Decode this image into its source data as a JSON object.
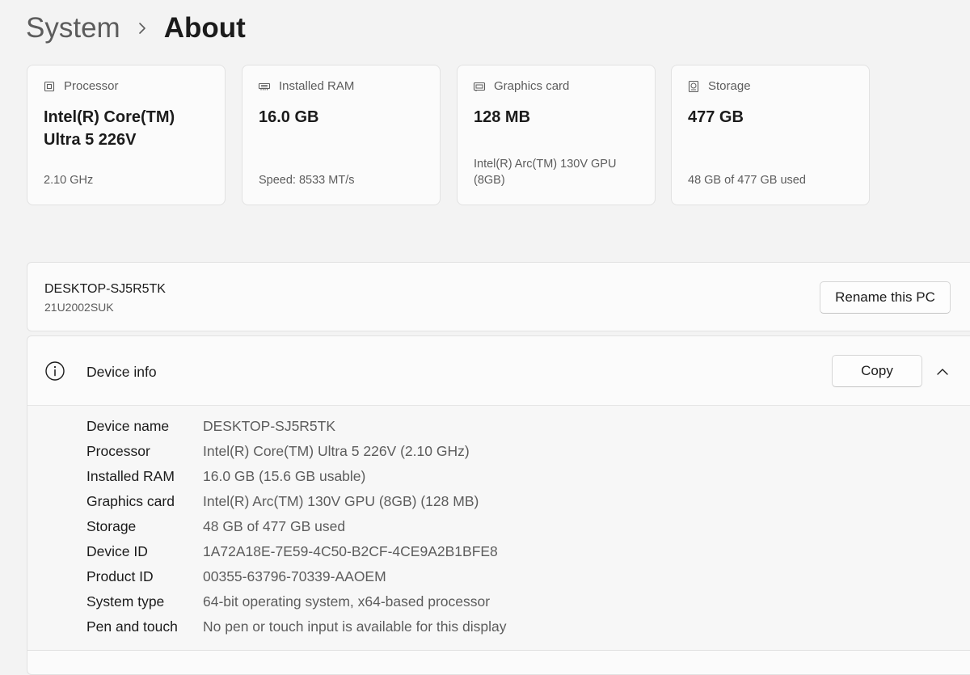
{
  "breadcrumb": {
    "parent": "System",
    "current": "About"
  },
  "spec_cards": [
    {
      "icon": "processor-icon",
      "label": "Processor",
      "value": "Intel(R) Core(TM) Ultra 5 226V",
      "detail": "2.10 GHz"
    },
    {
      "icon": "ram-icon",
      "label": "Installed RAM",
      "value": "16.0 GB",
      "detail": "Speed: 8533 MT/s"
    },
    {
      "icon": "graphics-card-icon",
      "label": "Graphics card",
      "value": "128 MB",
      "detail": "Intel(R) Arc(TM) 130V GPU (8GB)"
    },
    {
      "icon": "storage-icon",
      "label": "Storage",
      "value": "477 GB",
      "detail": "48 GB of 477 GB used"
    }
  ],
  "pc": {
    "name": "DESKTOP-SJ5R5TK",
    "model": "21U2002SUK",
    "rename_label": "Rename this PC"
  },
  "device_info": {
    "icon": "info-icon",
    "title": "Device info",
    "copy_label": "Copy",
    "rows": [
      {
        "label": "Device name",
        "value": "DESKTOP-SJ5R5TK"
      },
      {
        "label": "Processor",
        "value": "Intel(R) Core(TM) Ultra 5 226V (2.10 GHz)"
      },
      {
        "label": "Installed RAM",
        "value": "16.0 GB (15.6 GB usable)"
      },
      {
        "label": "Graphics card",
        "value": "Intel(R) Arc(TM) 130V GPU (8GB) (128 MB)"
      },
      {
        "label": "Storage",
        "value": "48 GB of 477 GB used"
      },
      {
        "label": "Device ID",
        "value": "1A72A18E-7E59-4C50-B2CF-4CE9A2B1BFE8"
      },
      {
        "label": "Product ID",
        "value": "00355-63796-70339-AAOEM"
      },
      {
        "label": "System type",
        "value": "64-bit operating system, x64-based processor"
      },
      {
        "label": "Pen and touch",
        "value": "No pen or touch input is available for this display"
      }
    ]
  },
  "colors": {
    "page_background": "#f3f3f3",
    "card_background": "#fbfbfb",
    "primary_text": "#1b1b1b",
    "secondary_text": "#5c5c5c"
  }
}
